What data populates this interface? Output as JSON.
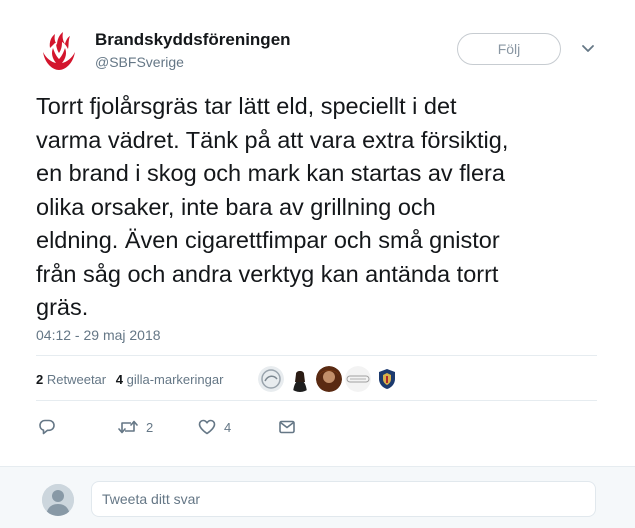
{
  "author": {
    "name": "Brandskyddsföreningen",
    "handle": "@SBFSverige"
  },
  "follow_button": {
    "label": "Följ"
  },
  "tweet": {
    "text": "Torrt fjolårsgräs tar lätt eld, speciellt i det\nvarma vädret. Tänk på att vara extra försiktig,\nen brand i skog och mark kan startas av flera\nolika orsaker, inte bara av grillning och\neldning. Även cigarettfimpar och små gnistor\nfrån såg och andra verktyg kan antända torrt\ngräs.",
    "timestamp": "04:12 - 29 maj 2018"
  },
  "stats": {
    "retweets_count": "2",
    "retweets_label": "Retweetar",
    "likes_count": "4",
    "likes_label": "gilla-markeringar"
  },
  "liker_avatars": [
    "liker-avatar-1",
    "liker-avatar-2",
    "liker-avatar-3",
    "liker-avatar-4",
    "liker-avatar-5"
  ],
  "actions": {
    "reply_icon": "reply-icon",
    "retweet_icon": "retweet-icon",
    "retweet_count": "2",
    "like_icon": "heart-icon",
    "like_count": "4",
    "dm_icon": "envelope-icon"
  },
  "reply_box": {
    "placeholder": "Tweeta ditt svar"
  },
  "colors": {
    "brand_red": "#d3152d",
    "text": "#14171a",
    "secondary": "#657786",
    "divider": "#e6ecf0",
    "reply_bg": "#f5f8fa"
  }
}
